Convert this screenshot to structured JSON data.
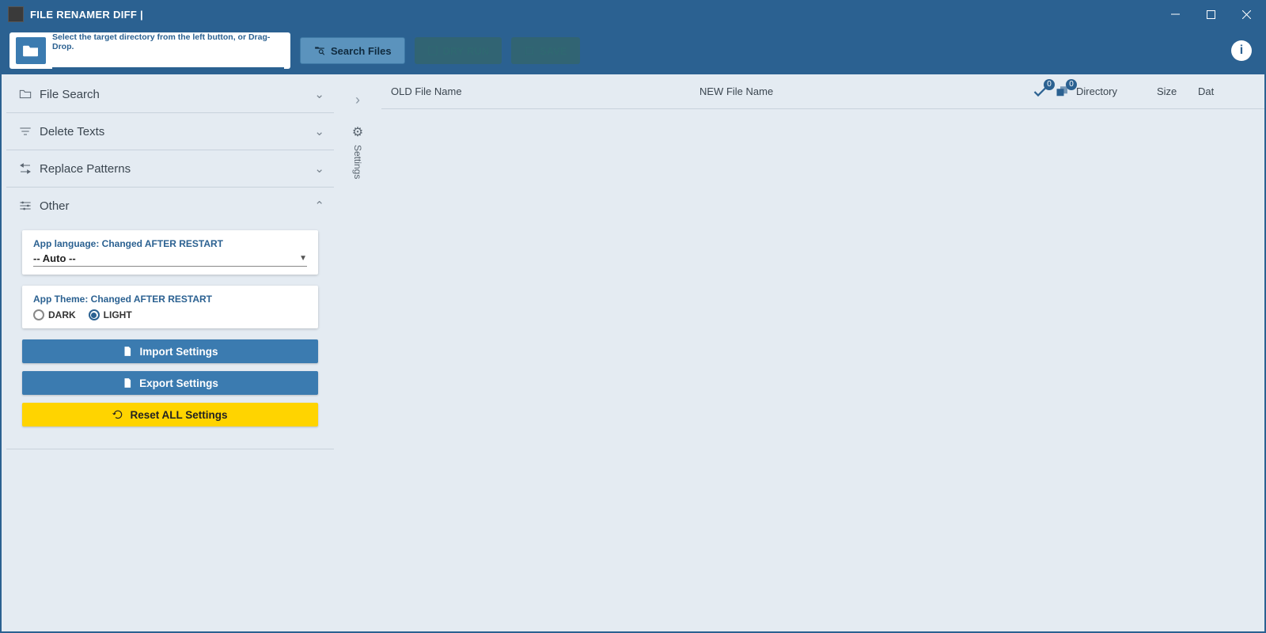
{
  "window": {
    "title": "FILE RENAMER DIFF |"
  },
  "toolbar": {
    "dir_hint": "Select the target directory from the left button, or Drag-Drop.",
    "dir_value": "",
    "search_label": "Search Files",
    "dryrun_label": "DRY RUN",
    "save_label": "SAVE"
  },
  "sidebar": {
    "sections": {
      "file_search": {
        "title": "File Search",
        "open": false
      },
      "delete_texts": {
        "title": "Delete Texts",
        "open": false
      },
      "replace_patterns": {
        "title": "Replace Patterns",
        "open": false
      },
      "other": {
        "title": "Other",
        "open": true
      }
    },
    "other": {
      "lang_label": "App language: Changed AFTER RESTART",
      "lang_value": "-- Auto --",
      "theme_label": "App Theme: Changed AFTER RESTART",
      "theme_options": {
        "dark": "DARK",
        "light": "LIGHT"
      },
      "theme_selected": "light",
      "import_label": "Import Settings",
      "export_label": "Export Settings",
      "reset_label": "Reset ALL Settings"
    }
  },
  "mid": {
    "settings_tab": "Settings"
  },
  "results": {
    "columns": {
      "old": "OLD File Name",
      "new": "NEW File Name",
      "dir": "Directory",
      "size": "Size",
      "date": "Dat"
    },
    "badge_check": "0",
    "badge_dup": "0"
  }
}
